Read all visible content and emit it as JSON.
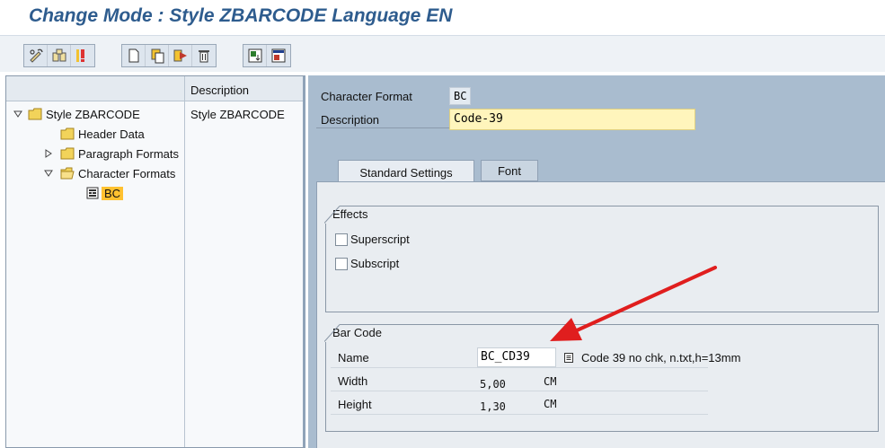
{
  "window": {
    "title": "Change Mode : Style ZBARCODE Language EN"
  },
  "toolbar": {
    "groups": [
      [
        "display-change-icon",
        "where-used-icon",
        "check-icon"
      ],
      [
        "create-icon",
        "copy-icon",
        "rename-icon",
        "delete-icon"
      ],
      [
        "import-icon",
        "export-icon"
      ]
    ]
  },
  "tree": {
    "header": {
      "name": "",
      "description": "Description"
    },
    "nodes": [
      {
        "label": "Style ZBARCODE",
        "description": "Style ZBARCODE",
        "expanded": true
      },
      {
        "label": "Header Data",
        "description": ""
      },
      {
        "label": "Paragraph Formats",
        "description": "",
        "expanded": false
      },
      {
        "label": "Character Formats",
        "description": "",
        "expanded": true
      },
      {
        "label": "BC",
        "description": "",
        "selected": true
      }
    ]
  },
  "header": {
    "char_format_label": "Character Format",
    "char_format_value": "BC",
    "description_label": "Description",
    "description_value": "Code-39"
  },
  "tabs": [
    {
      "label": "Standard Settings",
      "active": true
    },
    {
      "label": "Font",
      "active": false
    }
  ],
  "effects": {
    "title": "Effects",
    "superscript": {
      "label": "Superscript",
      "checked": false
    },
    "subscript": {
      "label": "Subscript",
      "checked": false
    }
  },
  "barcode": {
    "title": "Bar Code",
    "name_label": "Name",
    "name_value": "BC_CD39",
    "name_desc": "Code 39 no chk,  n.txt,h=13mm",
    "width_label": "Width",
    "width_value": "5,00",
    "width_unit": "CM",
    "height_label": "Height",
    "height_value": "1,30",
    "height_unit": "CM"
  },
  "colors": {
    "title": "#2e5c8e",
    "right_bg": "#a9bccf",
    "input_highlight": "#fff5bc",
    "selection": "#ffc130",
    "arrow": "#e01e1e"
  }
}
